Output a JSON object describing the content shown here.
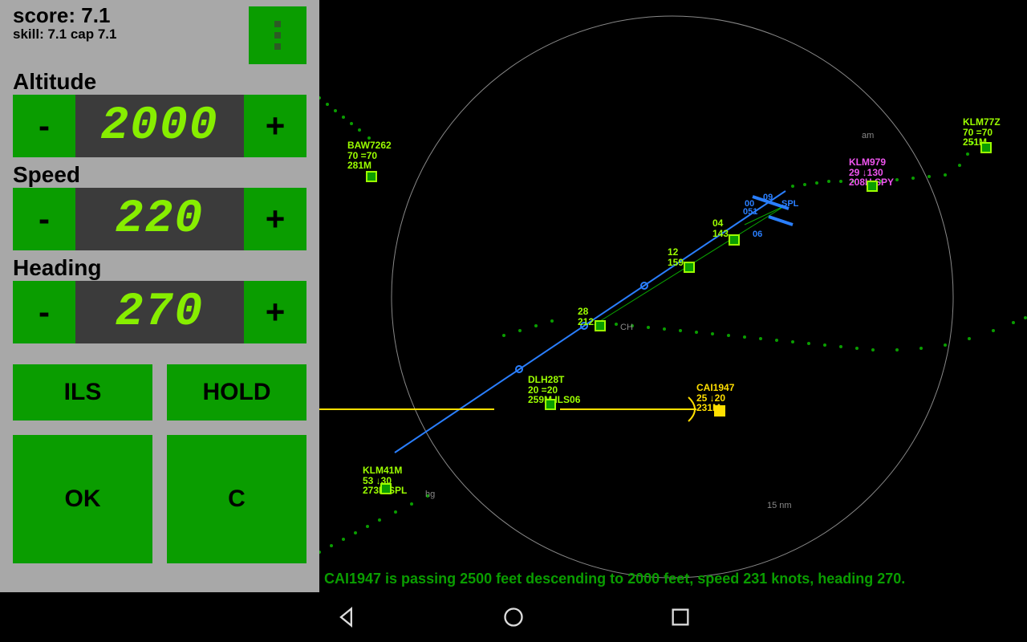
{
  "score": {
    "line": "score: 7.1",
    "skill": "skill: 7.1 cap 7.1"
  },
  "altitude": {
    "label": "Altitude",
    "value": "2000",
    "minus": "-",
    "plus": "+"
  },
  "speed": {
    "label": "Speed",
    "value": "220",
    "minus": "-",
    "plus": "+"
  },
  "heading": {
    "label": "Heading",
    "value": "270",
    "minus": "-",
    "plus": "+"
  },
  "buttons": {
    "ils": "ILS",
    "hold": "HOLD",
    "ok": "OK",
    "cancel": "C"
  },
  "status": "CAI1947 is passing 2500 feet descending to 2000 feet, speed 231 knots, heading 270.",
  "range_label": "15 nm",
  "waypoints": {
    "spl": "SPL",
    "ch": "CH",
    "hg": "hg",
    "am": "am"
  },
  "runways": {
    "r09": "09",
    "r00": "00",
    "r051": "051",
    "r06": "06"
  },
  "aircraft": {
    "baw7262": "BAW7262\n70 =70\n281M",
    "klm77z": "KLM77Z\n70 =70\n251M",
    "klm979": "KLM979\n29 ↓130\n208H SPY",
    "seq04": "04\n143",
    "seq12": "12\n159",
    "seq28": "28\n212",
    "dlh28t": "DLH28T\n20 =20\n259M ILS06",
    "cai1947": "CAI1947\n25 ↓20\n231M",
    "klm41m": "KLM41M\n53 ↓30\n273H SPL"
  }
}
